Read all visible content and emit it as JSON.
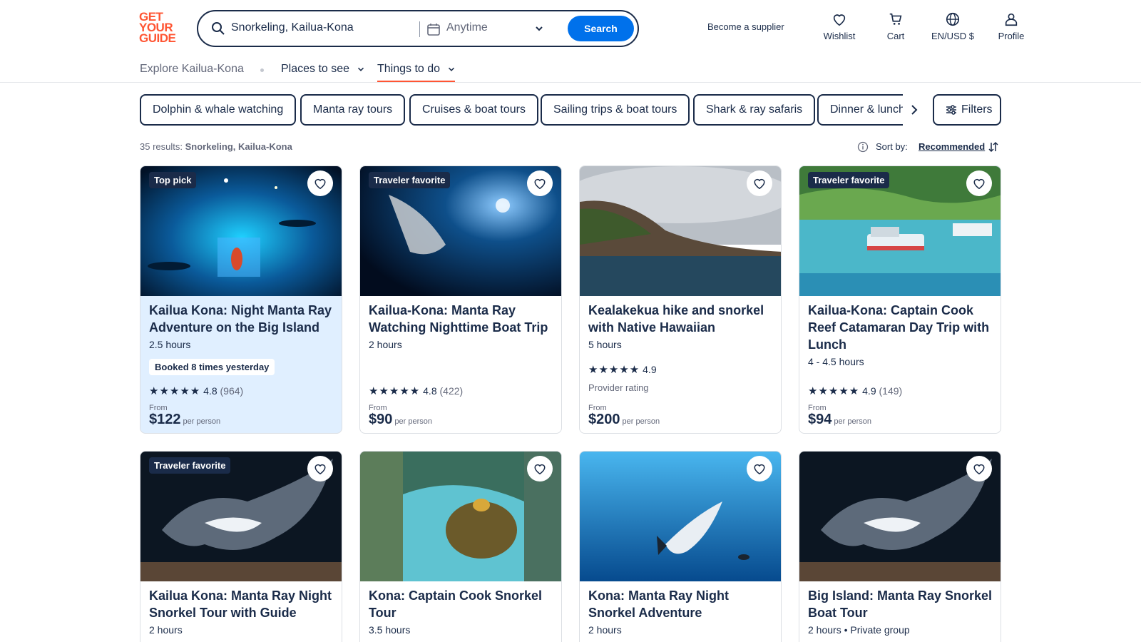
{
  "brand": {
    "logo_lines": [
      "GET",
      "YOUR",
      "GUIDE"
    ],
    "accent": "#ff5533",
    "navy": "#1a2b49",
    "blue": "#0071eb"
  },
  "search": {
    "location": "Snorkeling, Kailua-Kona",
    "date": "Anytime",
    "button": "Search"
  },
  "header_nav": {
    "supplier": "Become a supplier",
    "wishlist": "Wishlist",
    "cart": "Cart",
    "lang": "EN/USD $",
    "profile": "Profile"
  },
  "subnav": {
    "explore": "Explore Kailua-Kona",
    "places": "Places to see",
    "things": "Things to do"
  },
  "chips": [
    "Dolphin & whale watching",
    "Manta ray tours",
    "Cruises & boat tours",
    "Sailing trips & boat tours",
    "Shark & ray safaris",
    "Dinner & lunch cruises"
  ],
  "filters": "Filters",
  "results": {
    "count_text": "35 results:",
    "query": "Snorkeling, Kailua-Kona",
    "sort_label": "Sort by:",
    "sort_value": "Recommended"
  },
  "cards": [
    {
      "badge": "Top pick",
      "title": "Kailua Kona: Night Manta Ray Adventure on the Big Island",
      "duration": "2.5 hours",
      "booked": "Booked 8 times yesterday",
      "stars": "★★★★★",
      "rating": "4.8",
      "count": "(964)",
      "from": "From",
      "price": "$122",
      "per": "per person"
    },
    {
      "badge": "Traveler favorite",
      "title": "Kailua-Kona: Manta Ray Watching Nighttime Boat Trip",
      "duration": "2 hours",
      "stars": "★★★★★",
      "rating": "4.8",
      "count": "(422)",
      "from": "From",
      "price": "$90",
      "per": "per person"
    },
    {
      "title": "Kealakekua hike and snorkel with Native Hawaiian",
      "duration": "5 hours",
      "stars": "★★★★★",
      "rating": "4.9",
      "provider": "Provider rating",
      "from": "From",
      "price": "$200",
      "per": "per person"
    },
    {
      "badge": "Traveler favorite",
      "title": "Kailua-Kona: Captain Cook Reef Catamaran Day Trip with Lunch",
      "duration": "4 - 4.5 hours",
      "stars": "★★★★★",
      "rating": "4.9",
      "count": "(149)",
      "from": "From",
      "price": "$94",
      "per": "per person"
    },
    {
      "badge": "Traveler favorite",
      "title": "Kailua Kona: Manta Ray Night Snorkel Tour with Guide",
      "duration": "2 hours"
    },
    {
      "title": "Kona: Captain Cook Snorkel Tour",
      "duration": "3.5 hours"
    },
    {
      "title": "Kona: Manta Ray Night Snorkel Adventure",
      "duration": "2 hours"
    },
    {
      "title": "Big Island: Manta Ray Snorkel Boat Tour",
      "duration": "2 hours • Private group"
    }
  ]
}
